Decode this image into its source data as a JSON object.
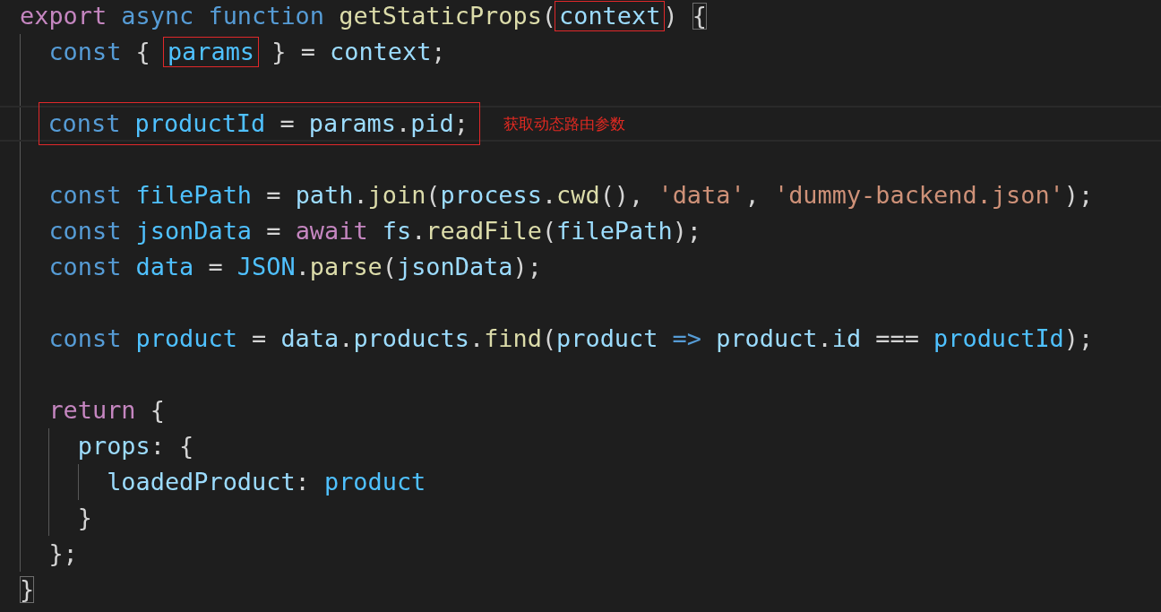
{
  "editor": {
    "lines": [
      {
        "tokens": [
          {
            "text": "export",
            "kind": "keyword"
          },
          {
            "text": "async",
            "kind": "storage",
            "sp": true
          },
          {
            "text": "function",
            "kind": "storage",
            "sp": true
          },
          {
            "text": "getStaticProps",
            "kind": "function",
            "sp": true
          },
          {
            "text": "(",
            "kind": "punct"
          },
          {
            "text": "context",
            "kind": "variable",
            "boxed": true
          },
          {
            "text": ")",
            "kind": "punct"
          },
          {
            "text": "{",
            "kind": "punct",
            "sp": true,
            "bracket_match": true
          }
        ],
        "children": [
          {
            "tokens": [
              {
                "text": "const",
                "kind": "storage"
              },
              {
                "text": "{",
                "kind": "punct",
                "sp": true
              },
              {
                "text": "params",
                "kind": "constant",
                "sp": true,
                "boxed": true
              },
              {
                "text": "}",
                "kind": "punct",
                "sp": true
              },
              {
                "text": "=",
                "kind": "punct",
                "sp": true
              },
              {
                "text": "context",
                "kind": "variable",
                "sp": true
              },
              {
                "text": ";",
                "kind": "punct"
              }
            ]
          },
          {
            "blank": true
          },
          {
            "current": true,
            "boxed": true,
            "note": "获取动态路由参数",
            "tokens": [
              {
                "text": "const",
                "kind": "storage"
              },
              {
                "text": "productId",
                "kind": "constant",
                "sp": true
              },
              {
                "text": "=",
                "kind": "punct",
                "sp": true
              },
              {
                "text": "params",
                "kind": "variable",
                "sp": true
              },
              {
                "text": ".",
                "kind": "punct"
              },
              {
                "text": "pid",
                "kind": "variable"
              },
              {
                "text": ";",
                "kind": "punct"
              }
            ]
          },
          {
            "blank": true
          },
          {
            "tokens": [
              {
                "text": "const",
                "kind": "storage"
              },
              {
                "text": "filePath",
                "kind": "constant",
                "sp": true
              },
              {
                "text": "=",
                "kind": "punct",
                "sp": true
              },
              {
                "text": "path",
                "kind": "variable",
                "sp": true
              },
              {
                "text": ".",
                "kind": "punct"
              },
              {
                "text": "join",
                "kind": "function"
              },
              {
                "text": "(",
                "kind": "punct"
              },
              {
                "text": "process",
                "kind": "variable"
              },
              {
                "text": ".",
                "kind": "punct"
              },
              {
                "text": "cwd",
                "kind": "function"
              },
              {
                "text": "(),",
                "kind": "punct"
              },
              {
                "text": "'data'",
                "kind": "string",
                "sp": true
              },
              {
                "text": ",",
                "kind": "punct"
              },
              {
                "text": "'dummy-backend.json'",
                "kind": "string",
                "sp": true
              },
              {
                "text": ");",
                "kind": "punct"
              }
            ]
          },
          {
            "tokens": [
              {
                "text": "const",
                "kind": "storage"
              },
              {
                "text": "jsonData",
                "kind": "constant",
                "sp": true
              },
              {
                "text": "=",
                "kind": "punct",
                "sp": true
              },
              {
                "text": "await",
                "kind": "keyword",
                "sp": true
              },
              {
                "text": "fs",
                "kind": "variable",
                "sp": true
              },
              {
                "text": ".",
                "kind": "punct"
              },
              {
                "text": "readFile",
                "kind": "function"
              },
              {
                "text": "(",
                "kind": "punct"
              },
              {
                "text": "filePath",
                "kind": "variable"
              },
              {
                "text": ");",
                "kind": "punct"
              }
            ]
          },
          {
            "tokens": [
              {
                "text": "const",
                "kind": "storage"
              },
              {
                "text": "data",
                "kind": "constant",
                "sp": true
              },
              {
                "text": "=",
                "kind": "punct",
                "sp": true
              },
              {
                "text": "JSON",
                "kind": "constant",
                "sp": true
              },
              {
                "text": ".",
                "kind": "punct"
              },
              {
                "text": "parse",
                "kind": "function"
              },
              {
                "text": "(",
                "kind": "punct"
              },
              {
                "text": "jsonData",
                "kind": "variable"
              },
              {
                "text": ");",
                "kind": "punct"
              }
            ]
          },
          {
            "blank": true
          },
          {
            "tokens": [
              {
                "text": "const",
                "kind": "storage"
              },
              {
                "text": "product",
                "kind": "constant",
                "sp": true
              },
              {
                "text": "=",
                "kind": "punct",
                "sp": true
              },
              {
                "text": "data",
                "kind": "variable",
                "sp": true
              },
              {
                "text": ".",
                "kind": "punct"
              },
              {
                "text": "products",
                "kind": "variable"
              },
              {
                "text": ".",
                "kind": "punct"
              },
              {
                "text": "find",
                "kind": "function"
              },
              {
                "text": "(",
                "kind": "punct"
              },
              {
                "text": "product",
                "kind": "variable"
              },
              {
                "text": "=>",
                "kind": "storage",
                "sp": true
              },
              {
                "text": "product",
                "kind": "variable",
                "sp": true
              },
              {
                "text": ".",
                "kind": "punct"
              },
              {
                "text": "id",
                "kind": "variable"
              },
              {
                "text": "===",
                "kind": "punct",
                "sp": true
              },
              {
                "text": "productId",
                "kind": "constant",
                "sp": true
              },
              {
                "text": ");",
                "kind": "punct"
              }
            ]
          },
          {
            "blank": true
          },
          {
            "tokens": [
              {
                "text": "return",
                "kind": "keyword"
              },
              {
                "text": "{",
                "kind": "punct",
                "sp": true
              }
            ],
            "children": [
              {
                "tokens": [
                  {
                    "text": "props",
                    "kind": "variable"
                  },
                  {
                    "text": ":",
                    "kind": "punct"
                  },
                  {
                    "text": "{",
                    "kind": "punct",
                    "sp": true
                  }
                ],
                "children": [
                  {
                    "tokens": [
                      {
                        "text": "loadedProduct",
                        "kind": "variable"
                      },
                      {
                        "text": ":",
                        "kind": "punct"
                      },
                      {
                        "text": "product",
                        "kind": "constant",
                        "sp": true
                      }
                    ]
                  }
                ]
              },
              {
                "tokens": [
                  {
                    "text": "}",
                    "kind": "punct"
                  }
                ]
              }
            ]
          },
          {
            "tokens": [
              {
                "text": "};",
                "kind": "punct"
              }
            ]
          }
        ]
      },
      {
        "tokens": [
          {
            "text": "}",
            "kind": "punct",
            "bracket_match": true
          }
        ]
      }
    ]
  }
}
